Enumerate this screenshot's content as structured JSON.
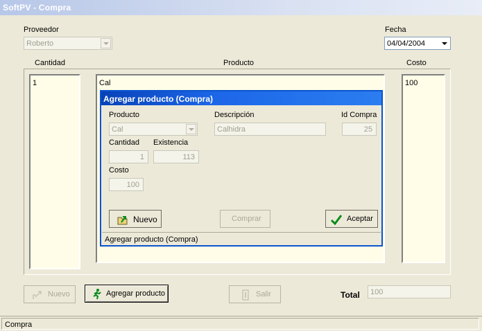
{
  "window": {
    "title": "SoftPV - Compra",
    "status": "Compra"
  },
  "form": {
    "proveedor_label": "Proveedor",
    "proveedor_value": "Roberto",
    "fecha_label": "Fecha",
    "fecha_value": "04/04/2004",
    "cantidad_header": "Cantidad",
    "producto_header": "Producto",
    "costo_header": "Costo",
    "cantidad_items": [
      "1"
    ],
    "producto_items": [
      "Cal"
    ],
    "costo_items": [
      "100"
    ],
    "total_label": "Total",
    "total_value": "100"
  },
  "buttons": {
    "nuevo": "Nuevo",
    "agregar_producto": "Agregar producto",
    "salir": "Salir"
  },
  "dialog": {
    "title": "Agregar producto (Compra)",
    "producto_label": "Producto",
    "producto_value": "Cal",
    "descripcion_label": "Descripción",
    "descripcion_value": "Calhidra",
    "id_compra_label": "Id Compra",
    "id_compra_value": "25",
    "cantidad_label": "Cantidad",
    "cantidad_value": "1",
    "existencia_label": "Existencia",
    "existencia_value": "113",
    "costo_label": "Costo",
    "costo_value": "100",
    "nuevo_button": "Nuevo",
    "comprar_button": "Comprar",
    "aceptar_button": "Aceptar",
    "status": "Agregar producto (Compra)"
  }
}
